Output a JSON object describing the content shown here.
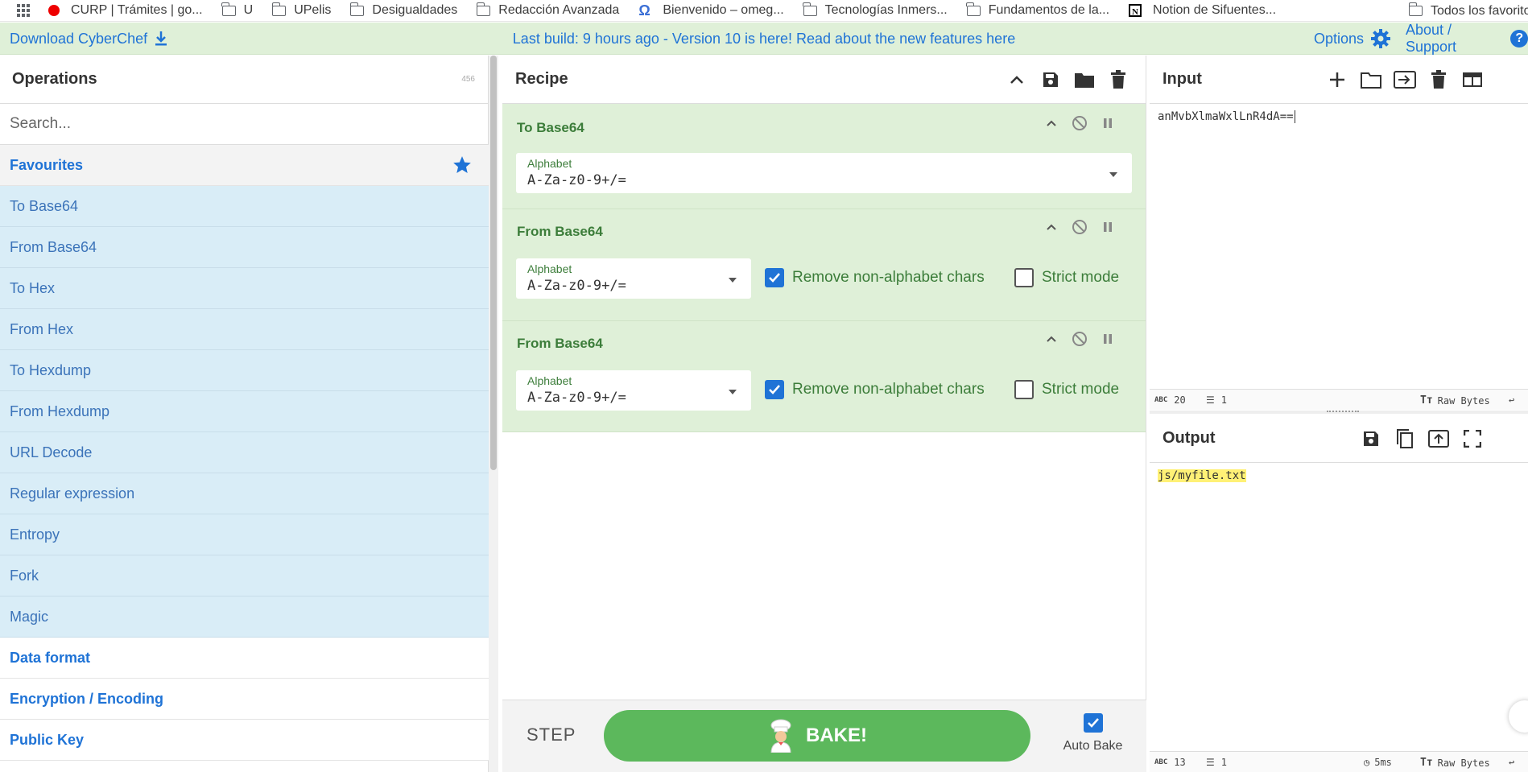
{
  "bookmarks": {
    "items": [
      {
        "label": "CURP | Trámites | go...",
        "icon": "red-circle-icon"
      },
      {
        "label": "U",
        "icon": "folder-icon"
      },
      {
        "label": "UPelis",
        "icon": "folder-icon"
      },
      {
        "label": "Desigualdades",
        "icon": "folder-icon"
      },
      {
        "label": "Redacción Avanzada",
        "icon": "folder-icon"
      },
      {
        "label": "Bienvenido – omeg...",
        "icon": "omega-icon"
      },
      {
        "label": "Tecnologías Inmers...",
        "icon": "folder-icon"
      },
      {
        "label": "Fundamentos de la...",
        "icon": "folder-icon"
      },
      {
        "label": "Notion de Sifuentes...",
        "icon": "notion-icon"
      }
    ],
    "all_label": "Todos los favoritos"
  },
  "banner": {
    "download_label": "Download CyberChef",
    "message": "Last build: 9 hours ago - Version 10 is here! Read about the new features here",
    "options_label": "Options",
    "about_label": "About / Support",
    "help_glyph": "?"
  },
  "operations": {
    "title": "Operations",
    "count": "456",
    "search_placeholder": "Search...",
    "favourites_label": "Favourites",
    "favourites": [
      "To Base64",
      "From Base64",
      "To Hex",
      "From Hex",
      "To Hexdump",
      "From Hexdump",
      "URL Decode",
      "Regular expression",
      "Entropy",
      "Fork",
      "Magic"
    ],
    "categories": [
      "Data format",
      "Encryption / Encoding",
      "Public Key"
    ]
  },
  "recipe": {
    "title": "Recipe",
    "ops": [
      {
        "name": "To Base64",
        "alphabet_label": "Alphabet",
        "alphabet": "A-Za-z0-9+/="
      },
      {
        "name": "From Base64",
        "alphabet_label": "Alphabet",
        "alphabet": "A-Za-z0-9+/=",
        "remove_label": "Remove non-alphabet chars",
        "remove_checked": true,
        "strict_label": "Strict mode",
        "strict_checked": false
      },
      {
        "name": "From Base64",
        "alphabet_label": "Alphabet",
        "alphabet": "A-Za-z0-9+/=",
        "remove_label": "Remove non-alphabet chars",
        "remove_checked": true,
        "strict_label": "Strict mode",
        "strict_checked": false
      }
    ],
    "step_label": "STEP",
    "bake_label": "BAKE!",
    "autobake_label": "Auto Bake",
    "autobake_checked": true
  },
  "input": {
    "title": "Input",
    "value": "anMvbXlmaWxlLnR4dA==",
    "stat_length": "20",
    "stat_lines": "1",
    "encoding_label": "Raw Bytes"
  },
  "output": {
    "title": "Output",
    "value": "js/myfile.txt",
    "stat_length": "13",
    "stat_lines": "1",
    "time": "5ms",
    "encoding_label": "Raw Bytes"
  },
  "colors": {
    "accent_blue": "#1f73d6",
    "recipe_green": "#dff0d8",
    "favourite_blue": "#d9edf7",
    "bake_green": "#5cb85c",
    "highlight_yellow": "#fff176"
  }
}
